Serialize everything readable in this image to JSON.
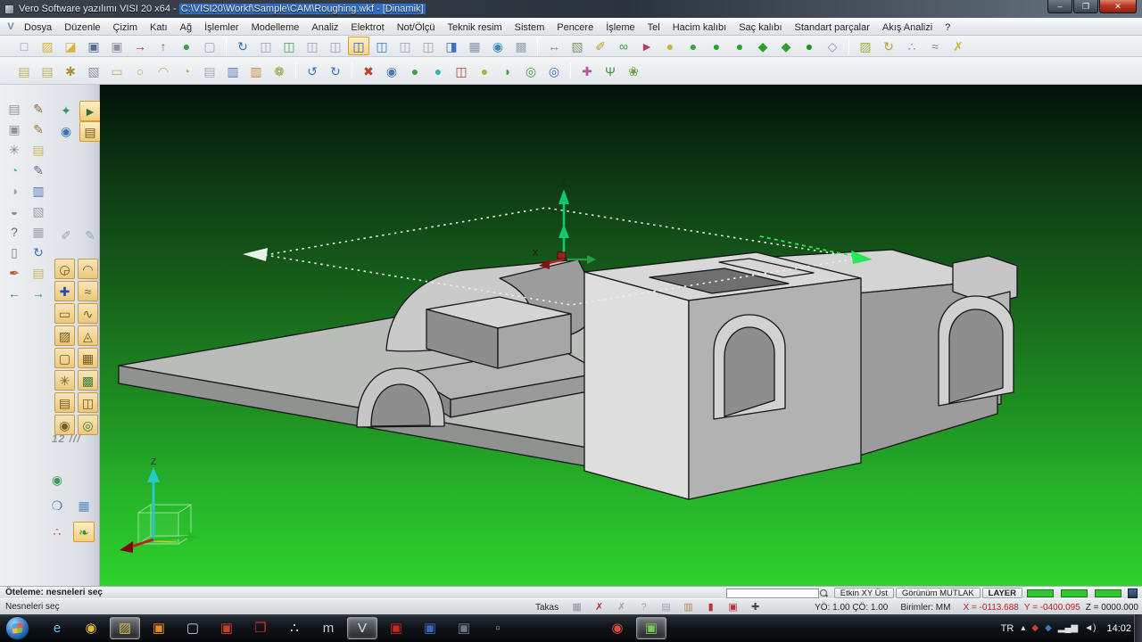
{
  "window": {
    "title_app": "Vero Software yazılımı VISI 20 x64 - ",
    "title_path": "C:\\VISI20\\Workf\\Sample\\CAM\\Roughing.wkf - [Dinamik]",
    "buttons": {
      "min": "–",
      "max": "❐",
      "close": "✕"
    }
  },
  "menubar": {
    "logo": "V",
    "items": [
      "Dosya",
      "Düzenle",
      "Çizim",
      "Katı",
      "Ağ",
      "İşlemler",
      "Modelleme",
      "Analiz",
      "Elektrot",
      "Not/Ölçü",
      "Teknik resim",
      "Sistem",
      "Pencere",
      "İşleme",
      "Tel",
      "Hacim kalıbı",
      "Saç kalıbı",
      "Standart parçalar",
      "Akış Analizi",
      "?"
    ]
  },
  "toolbar1": {
    "icons": [
      {
        "n": "new-document-icon",
        "g": "□",
        "c": "#8a94a2"
      },
      {
        "n": "open-file-icon",
        "g": "▨",
        "c": "#d9b43a"
      },
      {
        "n": "open-session-icon",
        "g": "◪",
        "c": "#d9b43a"
      },
      {
        "n": "save-icon",
        "g": "▣",
        "c": "#5a6a92"
      },
      {
        "n": "save-as-icon",
        "g": "▣",
        "c": "#8a94a2"
      },
      {
        "n": "export-icon",
        "g": "→",
        "c": "#b83a30"
      },
      {
        "n": "import-icon",
        "g": "↑",
        "c": "#3f8f3f"
      },
      {
        "n": "preferences-sphere-icon",
        "g": "●",
        "c": "#3fa03f"
      },
      {
        "n": "new-window-icon",
        "g": "▢",
        "c": "#9aa4b0"
      },
      {
        "sep": true
      },
      {
        "n": "regenerate-icon",
        "g": "↻",
        "c": "#3a72a8"
      },
      {
        "n": "view-cylinder-1-icon",
        "g": "◫",
        "c": "#98a2b0"
      },
      {
        "n": "view-cylinder-add-icon",
        "g": "◫",
        "c": "#4f9f4f"
      },
      {
        "n": "view-cylinder-2-icon",
        "g": "◫",
        "c": "#98a2b0"
      },
      {
        "n": "view-cylinder-3-icon",
        "g": "◫",
        "c": "#98a2b0"
      },
      {
        "n": "view-dynamic-icon",
        "g": "◫",
        "c": "#2a62c0",
        "a": true
      },
      {
        "n": "view-shaded-icon",
        "g": "◫",
        "c": "#3a72c0"
      },
      {
        "n": "view-wireframe-icon",
        "g": "◫",
        "c": "#98a2b0"
      },
      {
        "n": "view-hidden-line-icon",
        "g": "◫",
        "c": "#98a2b0"
      },
      {
        "n": "view-section-icon",
        "g": "◨",
        "c": "#3a72c0"
      },
      {
        "n": "grid-icon",
        "g": "▦",
        "c": "#8a94b0"
      },
      {
        "n": "globe-view-icon",
        "g": "◉",
        "c": "#3a8ac0"
      },
      {
        "n": "snap-grid-icon",
        "g": "▩",
        "c": "#9aa4b0"
      },
      {
        "sep": true
      },
      {
        "n": "transform-icon",
        "g": "↔",
        "c": "#7a8494"
      },
      {
        "n": "box-select-icon",
        "g": "▧",
        "c": "#7a9a6a"
      },
      {
        "n": "measure-key-icon",
        "g": "✐",
        "c": "#b8a030"
      },
      {
        "n": "link-chain-icon",
        "g": "∞",
        "c": "#3f9f3f"
      },
      {
        "n": "pick-cursor-icon",
        "g": "►",
        "c": "#b03a6a"
      },
      {
        "n": "shade-yellow-icon",
        "g": "●",
        "c": "#c8b838"
      },
      {
        "n": "shade-green-grid-icon",
        "g": "●",
        "c": "#3fa03f"
      },
      {
        "n": "render-sphere-1-icon",
        "g": "●",
        "c": "#2f9f2f"
      },
      {
        "n": "render-sphere-2-icon",
        "g": "●",
        "c": "#2f9f2f"
      },
      {
        "n": "render-cube-1-icon",
        "g": "◆",
        "c": "#2f9f2f"
      },
      {
        "n": "render-cube-2-icon",
        "g": "◆",
        "c": "#2f9f2f"
      },
      {
        "n": "render-solid-icon",
        "g": "●",
        "c": "#1f8f1f"
      },
      {
        "n": "render-wire-box-icon",
        "g": "◇",
        "c": "#8a94a2"
      },
      {
        "sep": true
      },
      {
        "n": "folder-green-icon",
        "g": "▨",
        "c": "#9faf3f"
      },
      {
        "n": "refresh-yellow-icon",
        "g": "↻",
        "c": "#b8a030"
      },
      {
        "n": "points-grid-icon",
        "g": "∴",
        "c": "#6a8ab8"
      },
      {
        "n": "wave-analysis-icon",
        "g": "≈",
        "c": "#6a8ab8"
      },
      {
        "n": "run-analysis-icon",
        "g": "✗",
        "c": "#c8b838"
      }
    ]
  },
  "toolbar2": {
    "icons": [
      {
        "n": "sketch-note-1-icon",
        "g": "▤",
        "c": "#c0b060"
      },
      {
        "n": "sketch-note-2-icon",
        "g": "▤",
        "c": "#c0b060"
      },
      {
        "n": "magic-tool-icon",
        "g": "✱",
        "c": "#b09030"
      },
      {
        "n": "solid-cube-icon",
        "g": "▧",
        "c": "#8a94a2"
      },
      {
        "n": "rect-tool-icon",
        "g": "▭",
        "c": "#c0b060"
      },
      {
        "n": "circle-tool-icon",
        "g": "○",
        "c": "#c0b060"
      },
      {
        "n": "arc-tool-icon",
        "g": "◠",
        "c": "#c0b060"
      },
      {
        "n": "spiral-tool-icon",
        "g": "◔",
        "c": "#c0b060"
      },
      {
        "n": "doc-star-icon",
        "g": "▤",
        "c": "#a8a8b8"
      },
      {
        "n": "doc-blue-icon",
        "g": "▥",
        "c": "#5a7ab8"
      },
      {
        "n": "doc-orange-icon",
        "g": "▥",
        "c": "#c88a3a"
      },
      {
        "n": "gear-tool-icon",
        "g": "❁",
        "c": "#8aa03a"
      },
      {
        "sep": true
      },
      {
        "n": "undo-icon",
        "g": "↺",
        "c": "#3a72c0"
      },
      {
        "n": "redo-icon",
        "g": "↻",
        "c": "#3a72c0"
      },
      {
        "sep": true
      },
      {
        "n": "tool-red-icon",
        "g": "✖",
        "c": "#c04030"
      },
      {
        "n": "tool-globe-icon",
        "g": "◉",
        "c": "#4a7ab0"
      },
      {
        "n": "ball-green-icon",
        "g": "●",
        "c": "#3fa03f"
      },
      {
        "n": "ball-cyan-icon",
        "g": "●",
        "c": "#3ab0b0"
      },
      {
        "n": "cylinder-red-icon",
        "g": "◫",
        "c": "#b04030"
      },
      {
        "n": "ball-yellow-icon",
        "g": "●",
        "c": "#a8b838"
      },
      {
        "n": "blade-green-icon",
        "g": "◗",
        "c": "#3fa03f"
      },
      {
        "n": "disc-green-icon",
        "g": "◎",
        "c": "#3fa03f"
      },
      {
        "n": "disc-blue-icon",
        "g": "◎",
        "c": "#3a72c0"
      },
      {
        "sep": true
      },
      {
        "n": "insect-tool-icon",
        "g": "✚",
        "c": "#b05a9a"
      },
      {
        "n": "plant-tool-icon",
        "g": "Ψ",
        "c": "#3f8f3f"
      },
      {
        "n": "flower-tool-icon",
        "g": "❀",
        "c": "#6fa03f"
      }
    ]
  },
  "sidebar": {
    "col_a": [
      {
        "n": "print-view-icon",
        "g": "▤",
        "c": "#8a94a2"
      },
      {
        "n": "pencil-delete-icon",
        "g": "✎",
        "c": "#8a6a3a"
      },
      {
        "n": "frame-tool-icon",
        "g": "▣",
        "c": "#8a94a2"
      },
      {
        "n": "pencil-spline-icon",
        "g": "✎",
        "c": "#a07a3a"
      },
      {
        "n": "spider-tool-icon",
        "g": "✳",
        "c": "#888888"
      },
      {
        "n": "yellow-note-icon",
        "g": "▤",
        "c": "#c8b860"
      },
      {
        "n": "sphere-pencil-icon",
        "g": "◔",
        "c": "#5ab0b0"
      },
      {
        "n": "pencil-edit-icon",
        "g": "✎",
        "c": "#5a6a92"
      },
      {
        "n": "sphere-gray-icon",
        "g": "◑",
        "c": "#9aa4ae"
      },
      {
        "n": "doc-blue-side-icon",
        "g": "▥",
        "c": "#5a7ab8"
      },
      {
        "n": "ball-arrow-icon",
        "g": "◒",
        "c": "#7a8a9a"
      },
      {
        "n": "box-gray-icon",
        "g": "▧",
        "c": "#9aa4b0"
      },
      {
        "n": "help-tool-icon",
        "g": "?",
        "c": "#5a6a92"
      },
      {
        "n": "table-tool-icon",
        "g": "▦",
        "c": "#9aa4b0"
      },
      {
        "n": "trash-icon",
        "g": "▯",
        "c": "#7a8a9a"
      },
      {
        "n": "refresh-blue-icon",
        "g": "↻",
        "c": "#3a72c0"
      },
      {
        "n": "paint-tool-icon",
        "g": "✒",
        "c": "#b05a2a"
      },
      {
        "n": "yellow-page-icon",
        "g": "▤",
        "c": "#c8b860"
      },
      {
        "n": "arrow-prev-icon",
        "g": "←",
        "c": "#2fa02f"
      },
      {
        "n": "arrow-next-icon",
        "g": "→",
        "c": "#2fa02f"
      }
    ],
    "col_b_top": [
      {
        "n": "parrot-icon",
        "g": "✦",
        "c": "#3a9a5a"
      },
      {
        "n": "selection-mode-icon",
        "g": "►",
        "c": "#3a6a3a",
        "a": true
      },
      {
        "n": "fish-icon",
        "g": "◉",
        "c": "#3a72c0"
      },
      {
        "n": "doc-edit-mode-icon",
        "g": "▤",
        "c": "#7a5a1a",
        "a": true
      }
    ],
    "col_b_mid": [
      {
        "n": "measure-gray-icon",
        "g": "✐",
        "c": "#9aa4ae"
      },
      {
        "n": "brush-gray-icon",
        "g": "✎",
        "c": "#9aa4ae"
      }
    ],
    "tan": [
      {
        "n": "snap-center-icon",
        "g": "◶",
        "c": "#7a5a1a"
      },
      {
        "n": "snap-arc-icon",
        "g": "◠",
        "c": "#7a5a1a"
      },
      {
        "n": "snap-plus-icon",
        "g": "✚",
        "c": "#2a4ab0"
      },
      {
        "n": "snap-curve-icon",
        "g": "≈",
        "c": "#7a5a1a"
      },
      {
        "n": "snap-rect-icon",
        "g": "▭",
        "c": "#7a5a1a"
      },
      {
        "n": "snap-freehand-icon",
        "g": "∿",
        "c": "#7a5a1a"
      },
      {
        "n": "snap-hatch-icon",
        "g": "▨",
        "c": "#7a5a1a"
      },
      {
        "n": "snap-solid-icon",
        "g": "◬",
        "c": "#7a5a1a"
      },
      {
        "n": "snap-plane-icon",
        "g": "▢",
        "c": "#7a5a1a"
      },
      {
        "n": "snap-grid-points-icon",
        "g": "▦",
        "c": "#7a5a1a"
      },
      {
        "n": "snap-mesh-icon",
        "g": "✳",
        "c": "#7a5a1a"
      },
      {
        "n": "snap-surface-icon",
        "g": "▩",
        "c": "#3f7f3f"
      },
      {
        "n": "snap-sheet-icon",
        "g": "▤",
        "c": "#7a5a1a"
      },
      {
        "n": "snap-cylinder-icon",
        "g": "◫",
        "c": "#7a5a1a"
      },
      {
        "n": "snap-eye-icon",
        "g": "◉",
        "c": "#7a5a1a"
      },
      {
        "n": "snap-globe-icon",
        "g": "◎",
        "c": "#3f7f3f"
      }
    ],
    "scale_label": "12 ///",
    "bottom": [
      {
        "n": "world-sphere-icon",
        "g": "◉",
        "c": "#3a9a5a"
      },
      {
        "blank": true
      },
      {
        "n": "balls-blue-icon",
        "g": "❍",
        "c": "#3a72c0"
      },
      {
        "n": "puzzle-blue-icon",
        "g": "▦",
        "c": "#5a8ac0"
      },
      {
        "n": "rgb-balls-icon",
        "g": "∴",
        "c": "#c03030"
      },
      {
        "n": "leaf-tool-icon",
        "g": "❧",
        "c": "#3f8f3f",
        "a": true
      }
    ]
  },
  "viewport": {
    "axis_z": "Z",
    "axis_x": "X",
    "ucs_z": "Z"
  },
  "statusbar": {
    "prompt": "Öteleme: nesneleri seç",
    "command": "Nesneleri seç",
    "search_value": "",
    "buttons": {
      "etkin": "Etkin XY Üst",
      "gorunum": "Görünüm MUTLAK",
      "layer": "LAYER"
    },
    "swatch_color": "#2fc82f",
    "takas": "Takas",
    "row_icons": [
      {
        "n": "calendar-icon",
        "g": "▦",
        "c": "#8a94a2"
      },
      {
        "n": "delete-red-icon",
        "g": "✗",
        "c": "#c03030"
      },
      {
        "n": "close-gray-icon",
        "g": "✗",
        "c": "#9aa4b0"
      },
      {
        "n": "help-gray-icon",
        "g": "?",
        "c": "#9aa4b0"
      },
      {
        "n": "doc-gray-icon",
        "g": "▤",
        "c": "#9aa4b0"
      },
      {
        "n": "notebook-icon",
        "g": "▥",
        "c": "#b08a4a"
      },
      {
        "n": "flag-red-icon",
        "g": "▮",
        "c": "#c03030"
      },
      {
        "n": "stop-red-icon",
        "g": "▣",
        "c": "#c03030"
      },
      {
        "n": "cursor-plus-icon",
        "g": "✚",
        "c": "#444444"
      }
    ],
    "yo": "YÖ: 1.00 ÇÖ: 1.00",
    "birimler": "Birimler: MM",
    "coord_x": "X = -0113.688",
    "coord_y": "Y = -0400.095",
    "coord_z": "Z = 0000.000"
  },
  "taskbar": {
    "apps": [
      {
        "n": "taskbar-ie-icon",
        "g": "e",
        "c": "#62b8f0"
      },
      {
        "n": "taskbar-chrome-icon",
        "g": "◉",
        "c": "#e8b83a"
      },
      {
        "n": "taskbar-explorer-icon",
        "g": "▨",
        "c": "#d8b858",
        "a": true
      },
      {
        "n": "taskbar-app-orange-icon",
        "g": "▣",
        "c": "#e8892a"
      },
      {
        "n": "taskbar-app-lightblue-icon",
        "g": "▢",
        "c": "#b8d0e8"
      },
      {
        "n": "taskbar-powerpoint-icon",
        "g": "▣",
        "c": "#c8402a"
      },
      {
        "n": "taskbar-pdf-icon",
        "g": "❐",
        "c": "#d23028"
      },
      {
        "n": "taskbar-app-white-icon",
        "g": "∴",
        "c": "#e8e8e8"
      },
      {
        "n": "taskbar-app-m-icon",
        "g": "m",
        "c": "#c8c8d0"
      },
      {
        "n": "taskbar-visi-icon",
        "g": "V",
        "c": "#cfe0f0",
        "a": true
      },
      {
        "n": "taskbar-adobe-icon",
        "g": "▣",
        "c": "#c02820"
      },
      {
        "n": "taskbar-app-blue-icon",
        "g": "▣",
        "c": "#3a68b8"
      },
      {
        "n": "taskbar-app-dark-icon",
        "g": "▣",
        "c": "#707880"
      },
      {
        "n": "taskbar-app-faint-icon",
        "g": "▫",
        "c": "#909898"
      },
      {
        "gap": true,
        "w": 96
      },
      {
        "n": "taskbar-chrome2-icon",
        "g": "◉",
        "c": "#e05038"
      },
      {
        "n": "taskbar-image-viewer-icon",
        "g": "▣",
        "c": "#78c858",
        "a": true
      }
    ],
    "lang": "TR",
    "tray_icons": [
      {
        "n": "tray-hidden-icon",
        "g": "▴",
        "c": "#dddddd"
      },
      {
        "n": "tray-security-icon",
        "g": "◆",
        "c": "#d04030"
      },
      {
        "n": "tray-update-icon",
        "g": "◆",
        "c": "#3a78c8"
      },
      {
        "n": "tray-network-icon",
        "g": "▂▄▆",
        "c": "#dddddd"
      },
      {
        "n": "tray-volume-icon",
        "g": "◄)",
        "c": "#dddddd"
      }
    ],
    "time": "14:02"
  }
}
